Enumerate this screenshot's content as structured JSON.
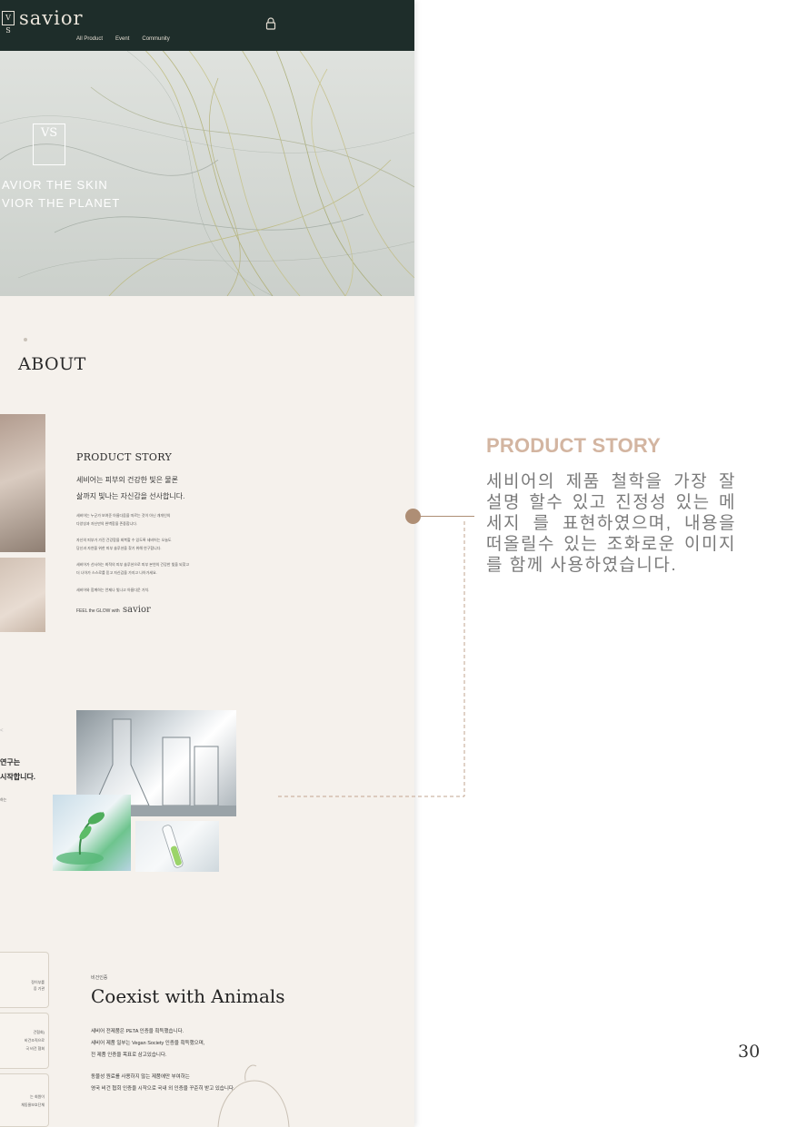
{
  "mockup": {
    "brand": "savior",
    "brand_mark": "V S",
    "nav": [
      "All Product",
      "Event",
      "Community"
    ],
    "hero": {
      "logo": "VS",
      "line1": "AVIOR THE SKIN",
      "line2": "VIOR THE PLANET"
    },
    "about_title": "ABOUT",
    "product_story": {
      "heading": "PRODUCT STORY",
      "lead1": "세비어는 피부의 건강한 빛은 물론",
      "lead2": "삶까지 빛나는 자신감을 선사합니다.",
      "small": [
        "세비어는 누군가 보여준 아름다움을 따르는 것이 아닌 개개인의",
        "다양성과 자신만의 완벽함을 존중합니다.",
        "자신의 피부가 가진 건강함을 회복할 수 있도록 세비어는 오늘도",
        "당신과 자연을 위한 피부 솔루션을 찾기 위해 연구합니다.",
        "세비어가 선사하는 최적의 피부 솔루션으로 피부 본연의 건강한 빛을 되찾고",
        "더 나아가 스스로를 믿고 자신감을 가지고 나아가세요.",
        "세비어와 함께하는 언제나 빛나고 아름다운 가치."
      ],
      "feel": "FEEL the GLOW with",
      "feel_logo": "savior"
    },
    "lab": {
      "mark": "<",
      "line1": "연구는",
      "line2": "시작합니다.",
      "line3": "하는"
    },
    "cert_cards": [
      {
        "l1": "정이부를",
        "l2": "증 기관"
      },
      {
        "l1": "건협회)",
        "l2": "비건조직으로",
        "l3": "국 비건 협회"
      },
      {
        "l1": "는 회원이",
        "l2": "체동물보호단체"
      }
    ],
    "vegan": {
      "small": "비건인증",
      "title": "Coexist with Animals",
      "p": [
        "세비어 전제품은 PETA 인증을 획득했습니다.",
        "세비어 제품 일부는 Vegan Society 인증을 획득했으며,",
        "전 제품 인증을 목표로 삼고있습니다.",
        "동물성 원료를 사용하지 않는 제품에만 부여하는",
        "영국 비건 협회 인증을 시작으로 국내 외 인증을 꾸준히 받고 있습니다."
      ]
    }
  },
  "annotation": {
    "title": "PRODUCT STORY",
    "body": "세비어의 제품 철학을 가장 잘 설명 할수 있고 진정성 있는 메세지 를 표현하였으며, 내용을 떠올릴수 있는 조화로운 이미지를 함께 사용하였습니다."
  },
  "page_number": "30",
  "colors": {
    "header": "#1e2d2a",
    "accent": "#ae8e75",
    "title": "#d3b5a1"
  },
  "icons": {
    "cart": "lock-icon"
  }
}
